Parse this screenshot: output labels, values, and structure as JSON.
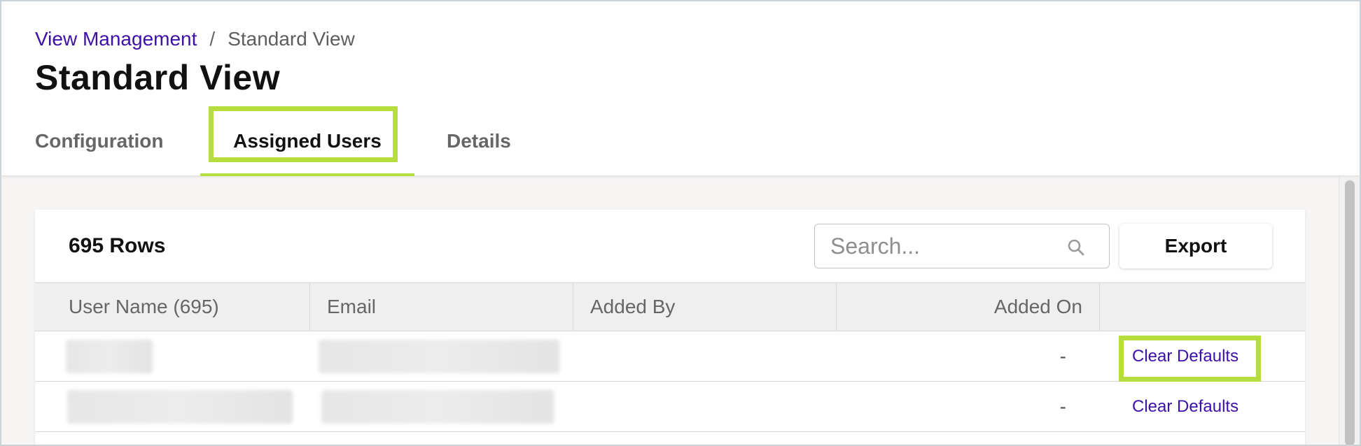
{
  "breadcrumb": {
    "parent": "View Management",
    "separator": "/",
    "current": "Standard View"
  },
  "page": {
    "title": "Standard View"
  },
  "tabs": [
    {
      "label": "Configuration",
      "active": false
    },
    {
      "label": "Assigned Users",
      "active": true
    },
    {
      "label": "Details",
      "active": false
    }
  ],
  "toolbar": {
    "row_count": "695 Rows",
    "search_placeholder": "Search...",
    "export_label": "Export"
  },
  "table": {
    "columns": [
      "User Name (695)",
      "Email",
      "Added By",
      "Added On",
      ""
    ],
    "rows": [
      {
        "user_name": "",
        "email": "",
        "added_by": "",
        "added_on": "-",
        "action": "Clear Defaults"
      },
      {
        "user_name": "",
        "email": "",
        "added_by": "",
        "added_on": "-",
        "action": "Clear Defaults"
      }
    ]
  },
  "colors": {
    "accent_link": "#3d10a8",
    "highlight": "#b5dd3e",
    "active_tab_underline": "#b5dd3e"
  },
  "icons": {
    "search": "search-icon"
  }
}
